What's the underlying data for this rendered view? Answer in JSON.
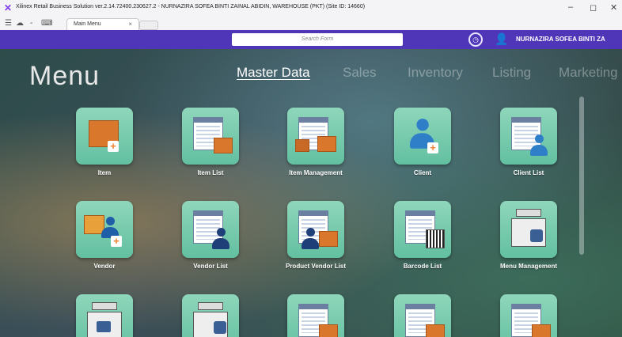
{
  "window": {
    "title": "Xilinex Retail Business Solution ver.2.14.72400.230627.2 - NURNAZIRA SOFEA BINTI ZAINAL ABIDIN, WAREHOUSE (PKT) (Site ID: 14660)",
    "tab_label": "Main Menu",
    "tab_close": "×",
    "minimize": "–",
    "maximize": "◻",
    "close": "✕"
  },
  "toolbar": {
    "search_placeholder": "Search Form",
    "user_name": "NURNAZIRA SOFEA BINTI ZA"
  },
  "menu": {
    "title": "Menu",
    "categories": [
      {
        "label": "Master Data",
        "active": true
      },
      {
        "label": "Sales",
        "active": false
      },
      {
        "label": "Inventory",
        "active": false
      },
      {
        "label": "Listing",
        "active": false
      },
      {
        "label": "Marketing",
        "active": false
      }
    ],
    "tiles": [
      {
        "label": "Item",
        "icon": "item-box-plus-icon"
      },
      {
        "label": "Item List",
        "icon": "item-list-icon"
      },
      {
        "label": "Item Management",
        "icon": "item-management-icon"
      },
      {
        "label": "Client",
        "icon": "client-add-icon"
      },
      {
        "label": "Client List",
        "icon": "client-list-icon"
      },
      {
        "label": "Vendor",
        "icon": "vendor-truck-icon"
      },
      {
        "label": "Vendor List",
        "icon": "vendor-list-icon"
      },
      {
        "label": "Product Vendor List",
        "icon": "product-vendor-list-icon"
      },
      {
        "label": "Barcode List",
        "icon": "barcode-list-icon"
      },
      {
        "label": "Menu Management",
        "icon": "menu-register-icon"
      }
    ]
  },
  "colors": {
    "toolbar": "#4f36b8",
    "tile": "#72c9a8",
    "box": "#d9782d",
    "person": "#2f7fc8"
  }
}
